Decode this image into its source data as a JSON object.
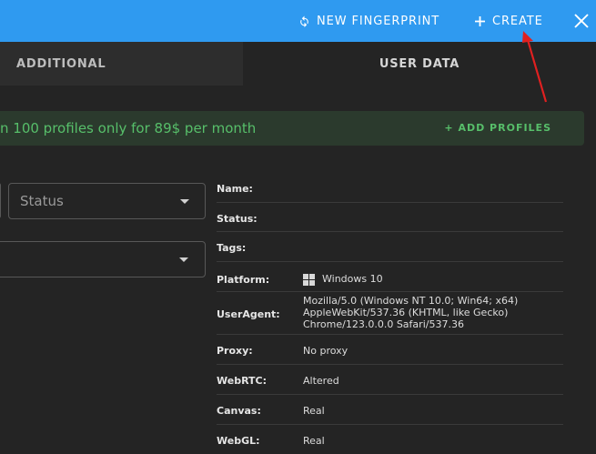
{
  "topbar": {
    "new_fingerprint_label": "NEW FINGERPRINT",
    "create_label": "CREATE",
    "accent_color": "#2f9af0"
  },
  "tabs": [
    {
      "label": "ADDITIONAL",
      "active": false
    },
    {
      "label": "USER DATA",
      "active": true
    }
  ],
  "promo": {
    "text": "n 100 profiles only for 89$ per month",
    "button_label": "+ ADD PROFILES",
    "text_color": "#57bf6a"
  },
  "filters": {
    "status_placeholder": "Status",
    "second_select_value": ""
  },
  "details": {
    "rows": [
      {
        "label": "Name:",
        "value": ""
      },
      {
        "label": "Status:",
        "value": ""
      },
      {
        "label": "Tags:",
        "value": ""
      },
      {
        "label": "Platform:",
        "value": "Windows 10",
        "icon": "windows-icon"
      },
      {
        "label": "UserAgent:",
        "value": "Mozilla/5.0 (Windows NT 10.0; Win64; x64)",
        "value_line2": "AppleWebKit/537.36 (KHTML, like Gecko)",
        "value_line3": "Chrome/123.0.0.0 Safari/537.36"
      },
      {
        "label": "Proxy:",
        "value": "No proxy"
      },
      {
        "label": "WebRTC:",
        "value": "Altered"
      },
      {
        "label": "Canvas:",
        "value": "Real"
      },
      {
        "label": "WebGL:",
        "value": "Real"
      }
    ]
  },
  "annotation": {
    "arrow_color": "#e02020"
  }
}
